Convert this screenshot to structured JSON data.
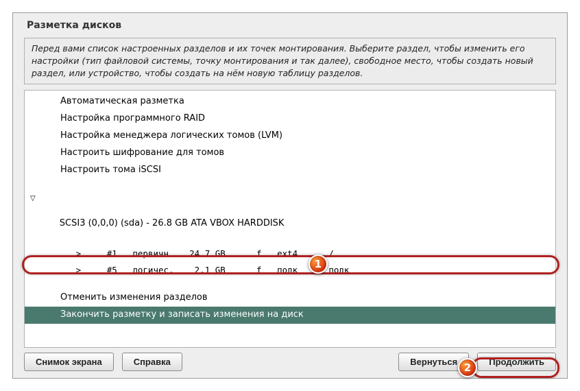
{
  "title": "Разметка дисков",
  "info_text": "Перед вами список настроенных разделов и их точек монтирования. Выберите раздел, чтобы изменить его настройки (тип файловой системы, точку монтирования и так далее), свободное место, чтобы создать новый раздел, или устройство, чтобы создать на нём новую таблицу разделов.",
  "menu": {
    "auto": "Автоматическая разметка",
    "raid": "Настройка программного RAID",
    "lvm": "Настройка менеджера логических томов (LVM)",
    "encrypt": "Настроить шифрование для томов",
    "iscsi": "Настроить тома iSCSI"
  },
  "disk": {
    "header": "SCSI3 (0,0,0) (sda) - 26.8 GB ATA VBOX HARDDISK",
    "parts": [
      "   >     #1   первичн.   24.7 GB      f   ext4      /",
      "   >     #5   логичес.    2.1 GB      f   подк      подк"
    ]
  },
  "actions": {
    "undo": "Отменить изменения разделов",
    "finish": "Закончить разметку и записать изменения на диск"
  },
  "buttons": {
    "screenshot": "Снимок экрана",
    "help": "Справка",
    "back": "Вернуться",
    "continue": "Продолжить"
  },
  "badges": {
    "one": "1",
    "two": "2"
  }
}
